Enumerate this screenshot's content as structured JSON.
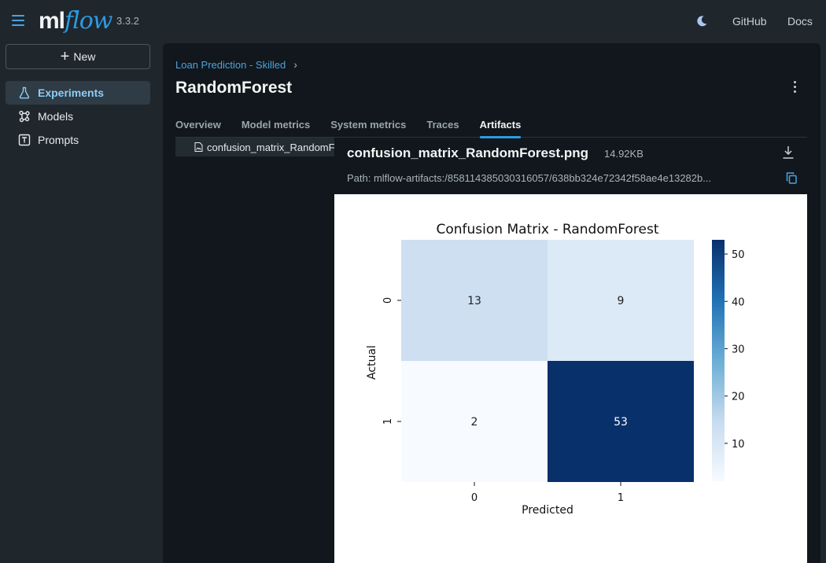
{
  "app": {
    "version": "3.3.2",
    "logo_ml": "ml",
    "logo_flow": "flow"
  },
  "topnav": {
    "github": "GitHub",
    "docs": "Docs"
  },
  "sidebar": {
    "new_label": "New",
    "items": [
      {
        "label": "Experiments",
        "icon": "beaker-icon",
        "active": true
      },
      {
        "label": "Models",
        "icon": "models-icon",
        "active": false
      },
      {
        "label": "Prompts",
        "icon": "prompt-icon",
        "active": false
      }
    ]
  },
  "breadcrumb": {
    "experiment": "Loan Prediction - Skilled"
  },
  "run": {
    "name": "RandomForest"
  },
  "tabs": [
    "Overview",
    "Model metrics",
    "System metrics",
    "Traces",
    "Artifacts"
  ],
  "active_tab": "Artifacts",
  "artifacts": {
    "tree_item": "confusion_matrix_RandomForest.png",
    "file_name": "confusion_matrix_RandomForest.png",
    "file_size": "14.92KB",
    "path": "Path: mlflow-artifacts:/858114385030316057/638bb324e72342f58ae4e13282b..."
  },
  "colors": {
    "accent": "#2c9be3",
    "active_nav_bg": "#2f3b45",
    "panel_bg": "#11171c"
  },
  "chart_data": {
    "type": "heatmap",
    "title": "Confusion Matrix - RandomForest",
    "xlabel": "Predicted",
    "ylabel": "Actual",
    "x_categories": [
      "0",
      "1"
    ],
    "y_categories": [
      "0",
      "1"
    ],
    "values": [
      [
        13,
        9
      ],
      [
        2,
        53
      ]
    ],
    "colormap": "Blues",
    "colorbar_ticks": [
      "10",
      "20",
      "30",
      "40",
      "50"
    ],
    "colorbar_range": [
      2,
      53
    ]
  }
}
